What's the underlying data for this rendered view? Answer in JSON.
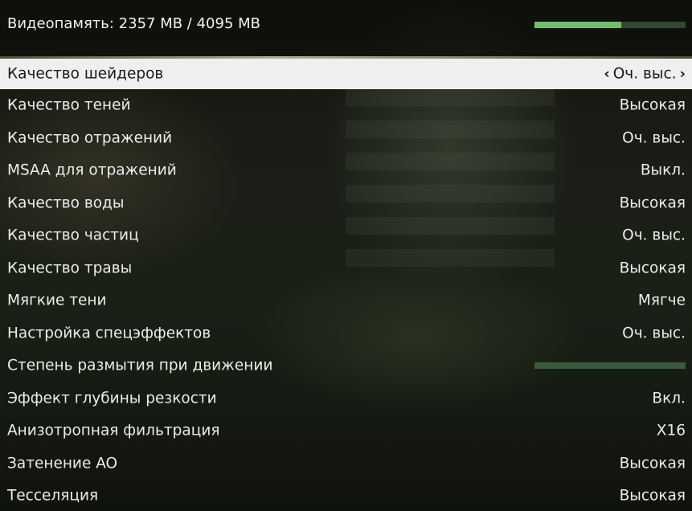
{
  "header": {
    "vram_label": "Видеопамять: 2357 MB / 4095 MB",
    "vram_fraction": 0.576
  },
  "settings": [
    {
      "label": "Качество шейдеров",
      "value": "Оч. выс.",
      "selected": true
    },
    {
      "label": "Качество теней",
      "value": "Высокая"
    },
    {
      "label": "Качество отражений",
      "value": "Оч. выс."
    },
    {
      "label": "MSAA для отражений",
      "value": "Выкл."
    },
    {
      "label": "Качество воды",
      "value": "Высокая"
    },
    {
      "label": "Качество частиц",
      "value": "Оч. выс."
    },
    {
      "label": "Качество травы",
      "value": "Высокая"
    },
    {
      "label": "Мягкие тени",
      "value": "Мягче"
    },
    {
      "label": "Настройка спецэффектов",
      "value": "Оч. выс."
    },
    {
      "label": "Степень размытия при движении",
      "slider_fraction": 0.0
    },
    {
      "label": "Эффект глубины резкости",
      "value": "Вкл."
    },
    {
      "label": "Анизотропная фильтрация",
      "value": "X16"
    },
    {
      "label": "Затенение AO",
      "value": "Высокая"
    },
    {
      "label": "Тесселяция",
      "value": "Высокая"
    }
  ],
  "icons": {
    "left": "chevron-left-icon",
    "right": "chevron-right-icon"
  },
  "colors": {
    "vram_fill": "#6cc06a",
    "vram_track": "#2f4a2f",
    "selected_row": "#efefef"
  }
}
